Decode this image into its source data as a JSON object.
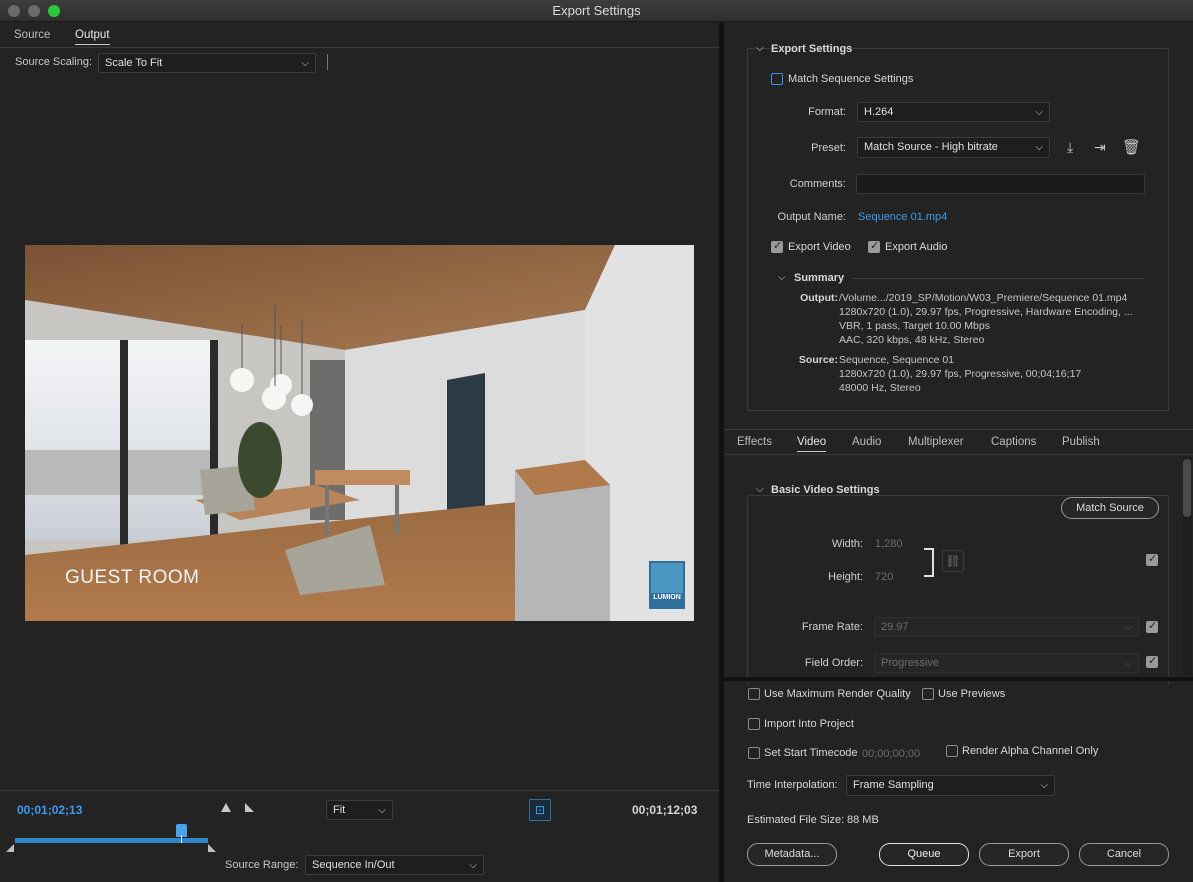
{
  "window": {
    "title": "Export Settings"
  },
  "left": {
    "tabs": [
      {
        "label": "Source"
      },
      {
        "label": "Output"
      }
    ],
    "source_scaling": {
      "label": "Source Scaling:",
      "value": "Scale To Fit"
    },
    "preview_overlay": {
      "caption": "GUEST ROOM",
      "badge": "LUMION"
    },
    "timeline": {
      "current_time": "00;01;02;13",
      "zoom": "Fit",
      "end_time": "00;01;12;03",
      "playhead_fraction": 0.86,
      "source_range_label": "Source Range:",
      "source_range_value": "Sequence In/Out"
    }
  },
  "export_settings": {
    "section_title": "Export Settings",
    "match_sequence_label": "Match Sequence Settings",
    "format_label": "Format:",
    "format_value": "H.264",
    "preset_label": "Preset:",
    "preset_value": "Match Source - High bitrate",
    "comments_label": "Comments:",
    "comments_value": "",
    "output_name_label": "Output Name:",
    "output_name_value": "Sequence 01.mp4",
    "export_video_label": "Export Video",
    "export_audio_label": "Export Audio",
    "summary_title": "Summary",
    "summary": {
      "output_label": "Output:",
      "output_lines": [
        "/Volume.../2019_SP/Motion/W03_Premiere/Sequence 01.mp4",
        "1280x720 (1.0), 29.97 fps, Progressive, Hardware Encoding, ...",
        "VBR, 1 pass, Target 10.00 Mbps",
        "AAC, 320 kbps, 48 kHz, Stereo"
      ],
      "source_label": "Source:",
      "source_lines": [
        "Sequence, Sequence 01",
        "1280x720 (1.0), 29.97 fps, Progressive, 00;04;16;17",
        "48000 Hz, Stereo"
      ]
    }
  },
  "settings_tabs": [
    {
      "label": "Effects"
    },
    {
      "label": "Video"
    },
    {
      "label": "Audio"
    },
    {
      "label": "Multiplexer"
    },
    {
      "label": "Captions"
    },
    {
      "label": "Publish"
    }
  ],
  "video": {
    "section_title": "Basic Video Settings",
    "match_source_label": "Match Source",
    "width_label": "Width:",
    "width_value": "1,280",
    "height_label": "Height:",
    "height_value": "720",
    "frame_rate_label": "Frame Rate:",
    "frame_rate_value": "29.97",
    "field_order_label": "Field Order:",
    "field_order_value": "Progressive"
  },
  "bottom": {
    "use_max_render_label": "Use Maximum Render Quality",
    "use_previews_label": "Use Previews",
    "import_into_project_label": "Import Into Project",
    "set_start_timecode_label": "Set Start Timecode",
    "start_timecode_value": "00;00;00;00",
    "render_alpha_label": "Render Alpha Channel Only",
    "time_interpolation_label": "Time Interpolation:",
    "time_interpolation_value": "Frame Sampling",
    "estimated_size_label": "Estimated File Size:",
    "estimated_size_value": "88 MB",
    "buttons": {
      "metadata": "Metadata...",
      "queue": "Queue",
      "export": "Export",
      "cancel": "Cancel"
    }
  },
  "colors": {
    "accent": "#3d9bf2",
    "timeline_bar": "#2f86c8",
    "panel_bg": "#232323"
  }
}
